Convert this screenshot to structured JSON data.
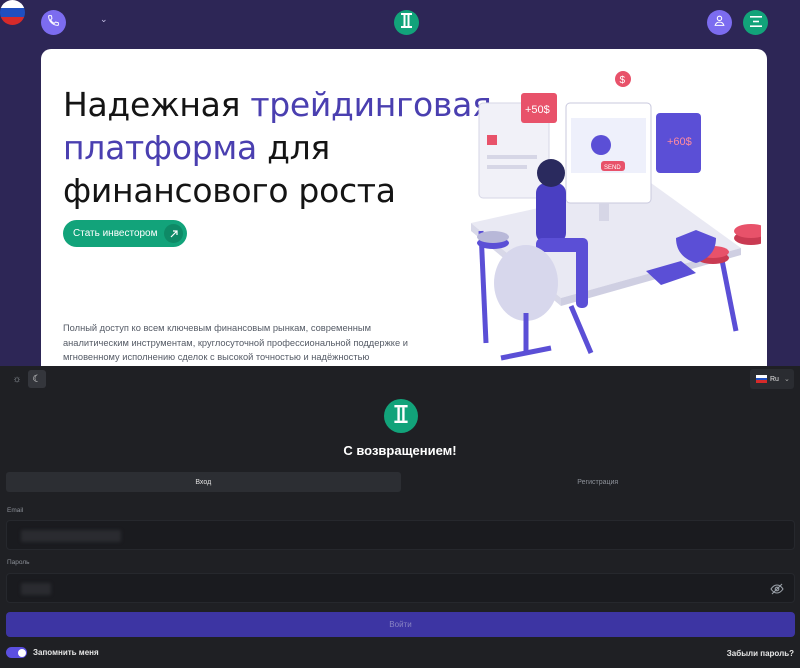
{
  "header": {
    "phone_icon": "phone-icon",
    "language_flag": "russia-flag",
    "logo_icon": "brand-logo-icon",
    "user_icon": "user-icon",
    "menu_icon": "menu-icon"
  },
  "hero": {
    "title_part1": "Надежная ",
    "title_accent": "трейдинговая платформа",
    "title_part2": " для финансового роста",
    "cta_label": "Стать инвестором",
    "cta_icon": "arrow-up-right-icon",
    "description": "Полный доступ ко всем ключевым финансовым рынкам, современным аналитическим инструментам, круглосуточной профессиональной поддержке и мгновенному исполнению сделок с высокой точностью и надёжностью",
    "illustration_labels": {
      "badge_left": "+50$",
      "badge_right": "+60$",
      "coin": "$",
      "chip": "SEND"
    }
  },
  "login": {
    "theme_light_icon": "sun-icon",
    "theme_dark_icon": "moon-icon",
    "language_label": "Ru",
    "title": "С возвращением!",
    "tabs": [
      {
        "label": "Вход",
        "active": true
      },
      {
        "label": "Регистрация",
        "active": false
      }
    ],
    "email_label": "Email",
    "password_label": "Пароль",
    "submit_label": "Войти",
    "remember_label": "Запомнить меня",
    "remember_checked": true,
    "forgot_label": "Забыли пароль?"
  },
  "colors": {
    "top_background": "#2d2656",
    "brand_green": "#12a37a",
    "brand_purple": "#7c6cf0",
    "accent_text": "#4a3fb0",
    "login_background": "#1f2024",
    "submit_button": "#3d35a3"
  }
}
